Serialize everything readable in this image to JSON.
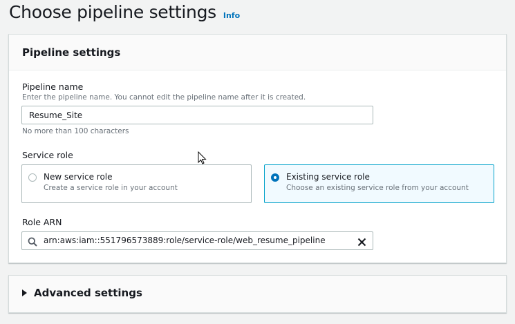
{
  "header": {
    "title": "Choose pipeline settings",
    "info_label": "Info"
  },
  "pipeline_settings": {
    "title": "Pipeline settings",
    "name_label": "Pipeline name",
    "name_description": "Enter the pipeline name. You cannot edit the pipeline name after it is created.",
    "name_value": "Resume_Site",
    "name_constraint": "No more than 100 characters",
    "service_role_label": "Service role",
    "service_role_options": [
      {
        "title": "New service role",
        "description": "Create a service role in your account",
        "selected": false
      },
      {
        "title": "Existing service role",
        "description": "Choose an existing service role from your account",
        "selected": true
      }
    ],
    "role_arn_label": "Role ARN",
    "role_arn_value": "arn:aws:iam::551796573889:role/service-role/web_resume_pipeline"
  },
  "advanced": {
    "label": "Advanced settings",
    "expanded": false
  },
  "colors": {
    "link": "#0073bb",
    "selected_border": "#00a1c9",
    "selected_bg": "#f1faff"
  }
}
